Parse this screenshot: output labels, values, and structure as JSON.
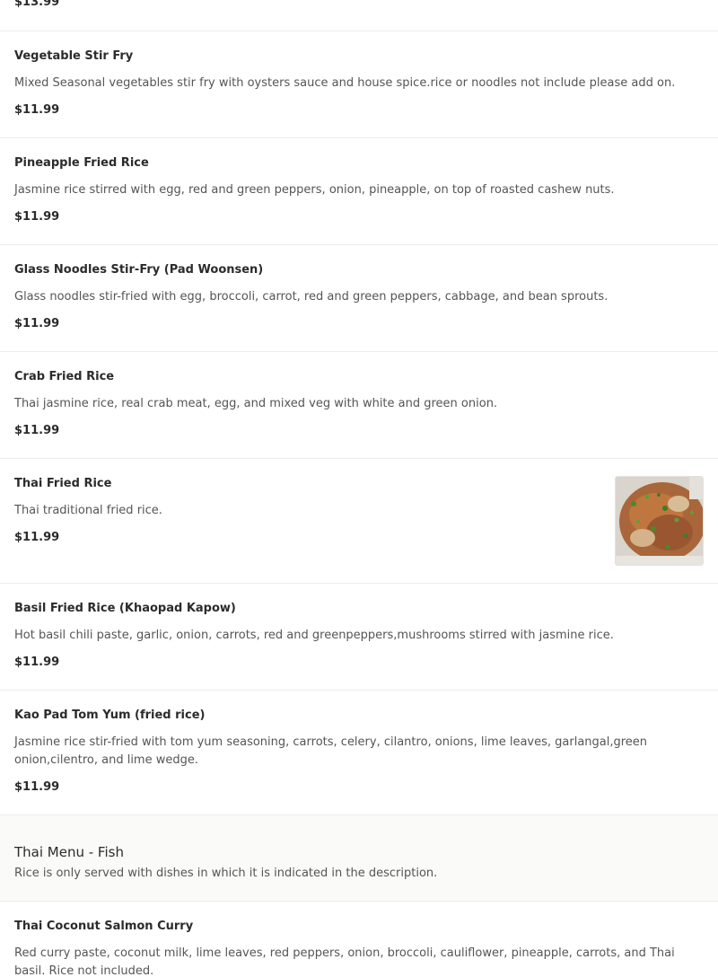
{
  "items_before": [
    {
      "price": "$13.99"
    },
    {
      "name": "Vegetable Stir Fry",
      "description": "Mixed Seasonal vegetables stir fry with oysters sauce and house spice.rice or noodles not include please add on.",
      "price": "$11.99"
    },
    {
      "name": "Pineapple Fried Rice",
      "description": "Jasmine rice stirred with egg, red and green peppers, onion, pineapple, on top of roasted cashew nuts.",
      "price": "$11.99"
    },
    {
      "name": "Glass Noodles Stir-Fry (Pad Woonsen)",
      "description": "Glass noodles stir-fried with egg, broccoli, carrot, red and green peppers, cabbage, and bean sprouts.",
      "price": "$11.99"
    },
    {
      "name": "Crab Fried Rice",
      "description": "Thai jasmine rice, real crab meat, egg, and mixed veg with white and green onion.",
      "price": "$11.99"
    },
    {
      "name": "Thai Fried Rice",
      "description": "Thai traditional fried rice.",
      "price": "$11.99",
      "photo": "fried-rice-photo"
    },
    {
      "name": "Basil Fried Rice (Khaopad Kapow)",
      "description": "Hot basil chili paste, garlic, onion, carrots, red and greenpeppers,mushrooms stirred with jasmine rice.",
      "price": "$11.99"
    },
    {
      "name": "Kao Pad Tom Yum (fried rice)",
      "description": "Jasmine rice stir-fried with tom yum seasoning, carrots, celery, cilantro, onions, lime leaves, garlangal,green onion,cilentro, and lime wedge.",
      "price": "$11.99"
    }
  ],
  "section": {
    "title": "Thai Menu - Fish",
    "note": "Rice is only served with dishes in which it is indicated in the description."
  },
  "items_after": [
    {
      "name": "Thai Coconut Salmon Curry",
      "description": "Red curry paste, coconut milk, lime leaves, red peppers, onion, broccoli, cauliflower, pineapple, carrots, and Thai basil. Rice not included."
    }
  ]
}
